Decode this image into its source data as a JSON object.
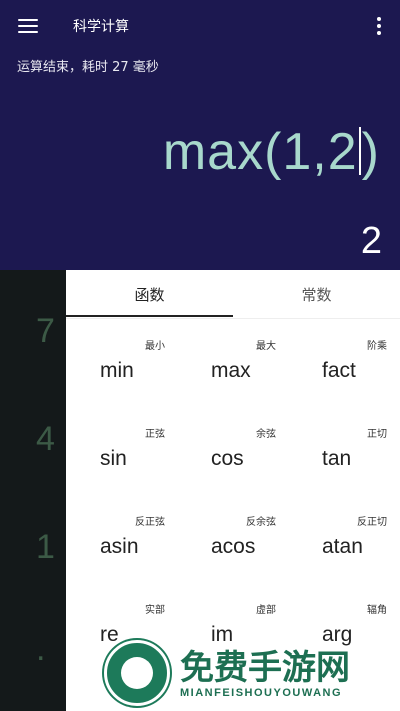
{
  "app_bar": {
    "title": "科学计算",
    "menu_icon": "hamburger-menu-icon",
    "more_icon": "more-vertical-icon"
  },
  "display": {
    "status": "运算结束，耗时 27 毫秒",
    "expression_before_cursor": "max(1,2",
    "expression_after_cursor": ")",
    "result": "2"
  },
  "keypad": {
    "digits": [
      "7",
      "4",
      "1",
      "."
    ]
  },
  "function_panel": {
    "tabs": [
      {
        "label": "函数",
        "active": true
      },
      {
        "label": "常数",
        "active": false
      }
    ],
    "functions": [
      {
        "sub": "最小",
        "name": "min"
      },
      {
        "sub": "最大",
        "name": "max"
      },
      {
        "sub": "阶乘",
        "name": "fact"
      },
      {
        "sub": "正弦",
        "name": "sin"
      },
      {
        "sub": "余弦",
        "name": "cos"
      },
      {
        "sub": "正切",
        "name": "tan"
      },
      {
        "sub": "反正弦",
        "name": "asin"
      },
      {
        "sub": "反余弦",
        "name": "acos"
      },
      {
        "sub": "反正切",
        "name": "atan"
      },
      {
        "sub": "实部",
        "name": "re"
      },
      {
        "sub": "虚部",
        "name": "im"
      },
      {
        "sub": "辐角",
        "name": "arg"
      }
    ]
  },
  "watermark": {
    "title": "免费手游网",
    "subtitle": "MIANFEISHOUYOUWANG"
  },
  "colors": {
    "header_bg": "#1c1850",
    "expression": "#a8d8cc",
    "panel_bg": "#ffffff",
    "keypad_bg": "#14191a",
    "watermark": "#1d6f52"
  }
}
